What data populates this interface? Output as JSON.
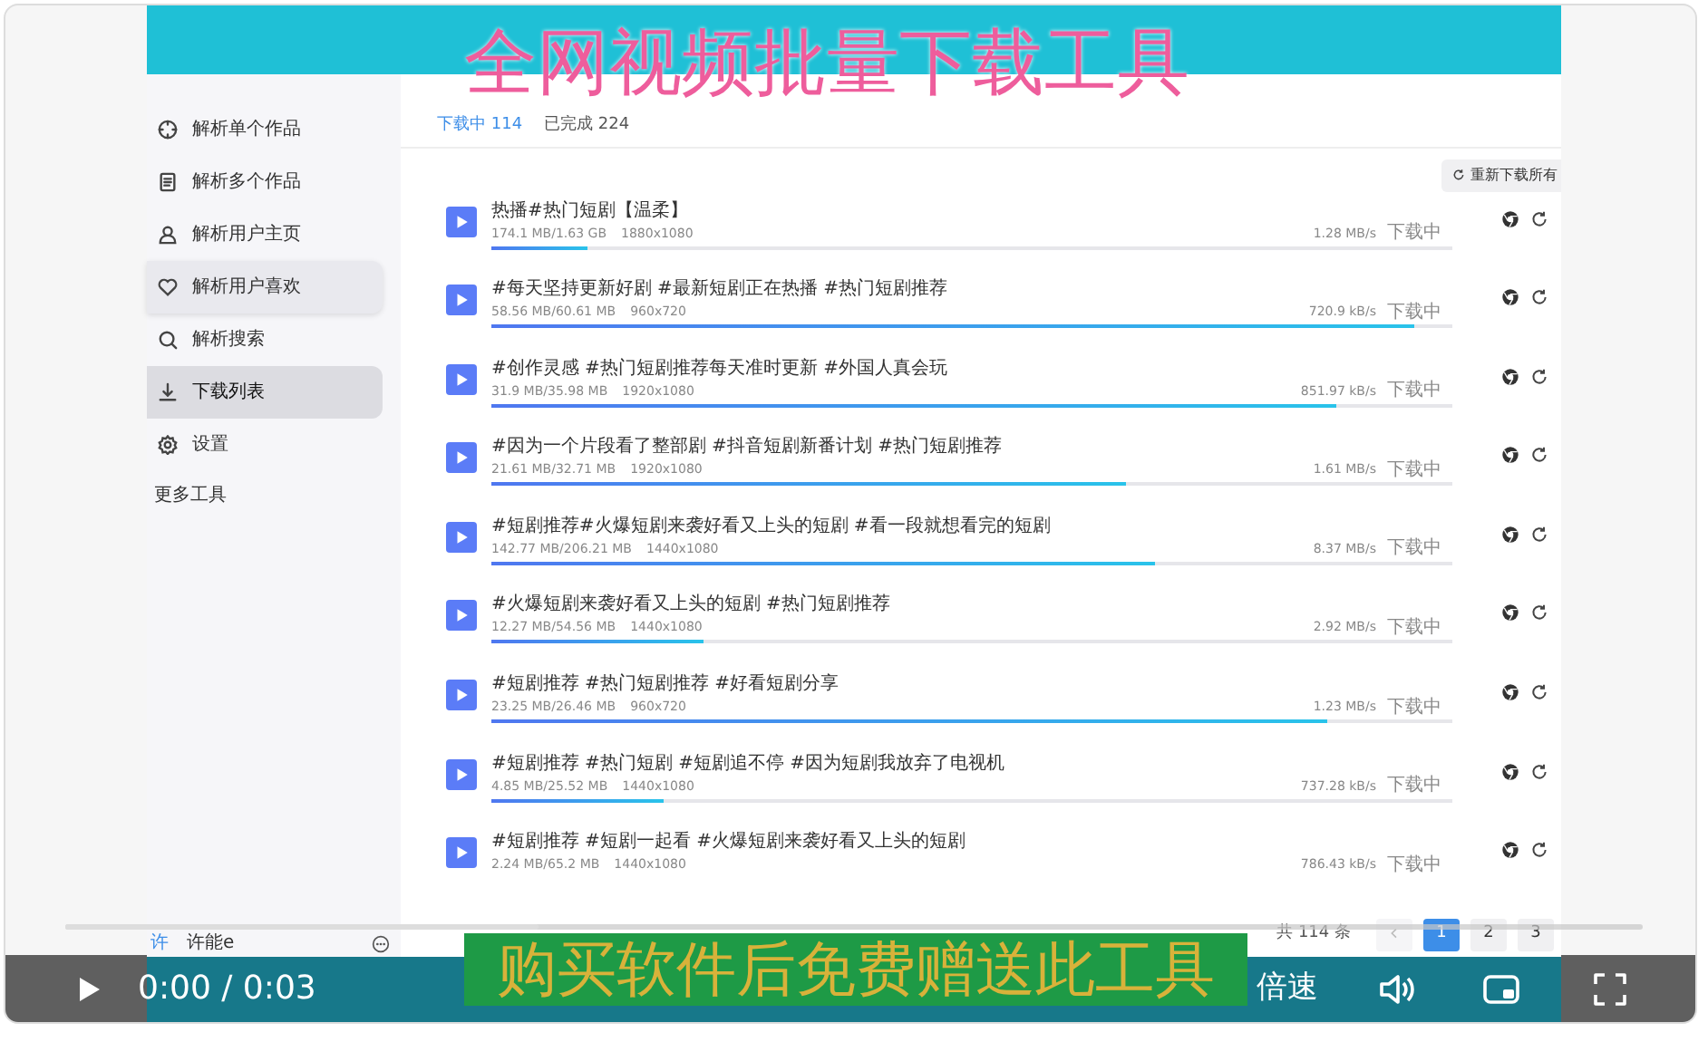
{
  "overlay_title": "全网视频批量下载工具",
  "sidebar": {
    "items": [
      {
        "label": "解析单个作品",
        "selected": false,
        "hovered": false
      },
      {
        "label": "解析多个作品",
        "selected": false,
        "hovered": false
      },
      {
        "label": "解析用户主页",
        "selected": false,
        "hovered": false
      },
      {
        "label": "解析用户喜欢",
        "selected": false,
        "hovered": true
      },
      {
        "label": "解析搜索",
        "selected": false,
        "hovered": false
      },
      {
        "label": "下载列表",
        "selected": true,
        "hovered": false
      },
      {
        "label": "设置",
        "selected": false,
        "hovered": false
      }
    ],
    "section": "更多工具",
    "user": {
      "avatar": "许",
      "name": "许能e"
    }
  },
  "tabs": [
    {
      "label": "下载中",
      "count": "114",
      "selected": true
    },
    {
      "label": "已完成",
      "count": "224",
      "selected": false
    }
  ],
  "redownload_button": "重新下载所有",
  "downloads": [
    {
      "title": "热播#热门短剧【温柔】",
      "size": "174.1 MB/1.63 GB",
      "resolution": "1880x1080",
      "speed": "1.28 MB/s",
      "status": "下载中",
      "level": 0.1
    },
    {
      "title": "#每天坚持更新好剧 #最新短剧正在热播 #热门短剧推荐",
      "size": "58.56 MB/60.61 MB",
      "resolution": "960x720",
      "speed": "720.9 kB/s",
      "status": "下载中",
      "level": 0.96
    },
    {
      "title": "#创作灵感 #热门短剧推荐每天准时更新 #外国人真会玩",
      "size": "31.9 MB/35.98 MB",
      "resolution": "1920x1080",
      "speed": "851.97 kB/s",
      "status": "下载中",
      "level": 0.88
    },
    {
      "title": "#因为一个片段看了整部剧 #抖音短剧新番计划 #热门短剧推荐",
      "size": "21.61 MB/32.71 MB",
      "resolution": "1920x1080",
      "speed": "1.61 MB/s",
      "status": "下载中",
      "level": 0.66
    },
    {
      "title": "#短剧推荐#火爆短剧来袭好看又上头的短剧 #看一段就想看完的短剧",
      "size": "142.77 MB/206.21 MB",
      "resolution": "1440x1080",
      "speed": "8.37 MB/s",
      "status": "下载中",
      "level": 0.69
    },
    {
      "title": "#火爆短剧来袭好看又上头的短剧 #热门短剧推荐",
      "size": "12.27 MB/54.56 MB",
      "resolution": "1440x1080",
      "speed": "2.92 MB/s",
      "status": "下载中",
      "level": 0.22
    },
    {
      "title": "#短剧推荐 #热门短剧推荐 #好看短剧分享",
      "size": "23.25 MB/26.46 MB",
      "resolution": "960x720",
      "speed": "1.23 MB/s",
      "status": "下载中",
      "level": 0.87
    },
    {
      "title": "#短剧推荐 #热门短剧 #短剧追不停 #因为短剧我放弃了电视机",
      "size": "4.85 MB/25.52 MB",
      "resolution": "1440x1080",
      "speed": "737.28 kB/s",
      "status": "下载中",
      "level": 0.18
    },
    {
      "title": "#短剧推荐 #短剧一起看 #火爆短剧来袭好看又上头的短剧",
      "size": "2.24 MB/65.2 MB",
      "resolution": "1440x1080",
      "speed": "786.43 kB/s",
      "status": "下载中"
    }
  ],
  "pagination": {
    "total": "共 114 条",
    "pages": [
      {
        "label": "1",
        "selected": true
      },
      {
        "label": "2",
        "selected": false
      },
      {
        "label": "3",
        "selected": false
      }
    ]
  },
  "player": {
    "time": "0:00 / 0:03",
    "speed_button": "倍速",
    "level": 0.3
  },
  "caption": "购买软件后免费赠送此工具"
}
